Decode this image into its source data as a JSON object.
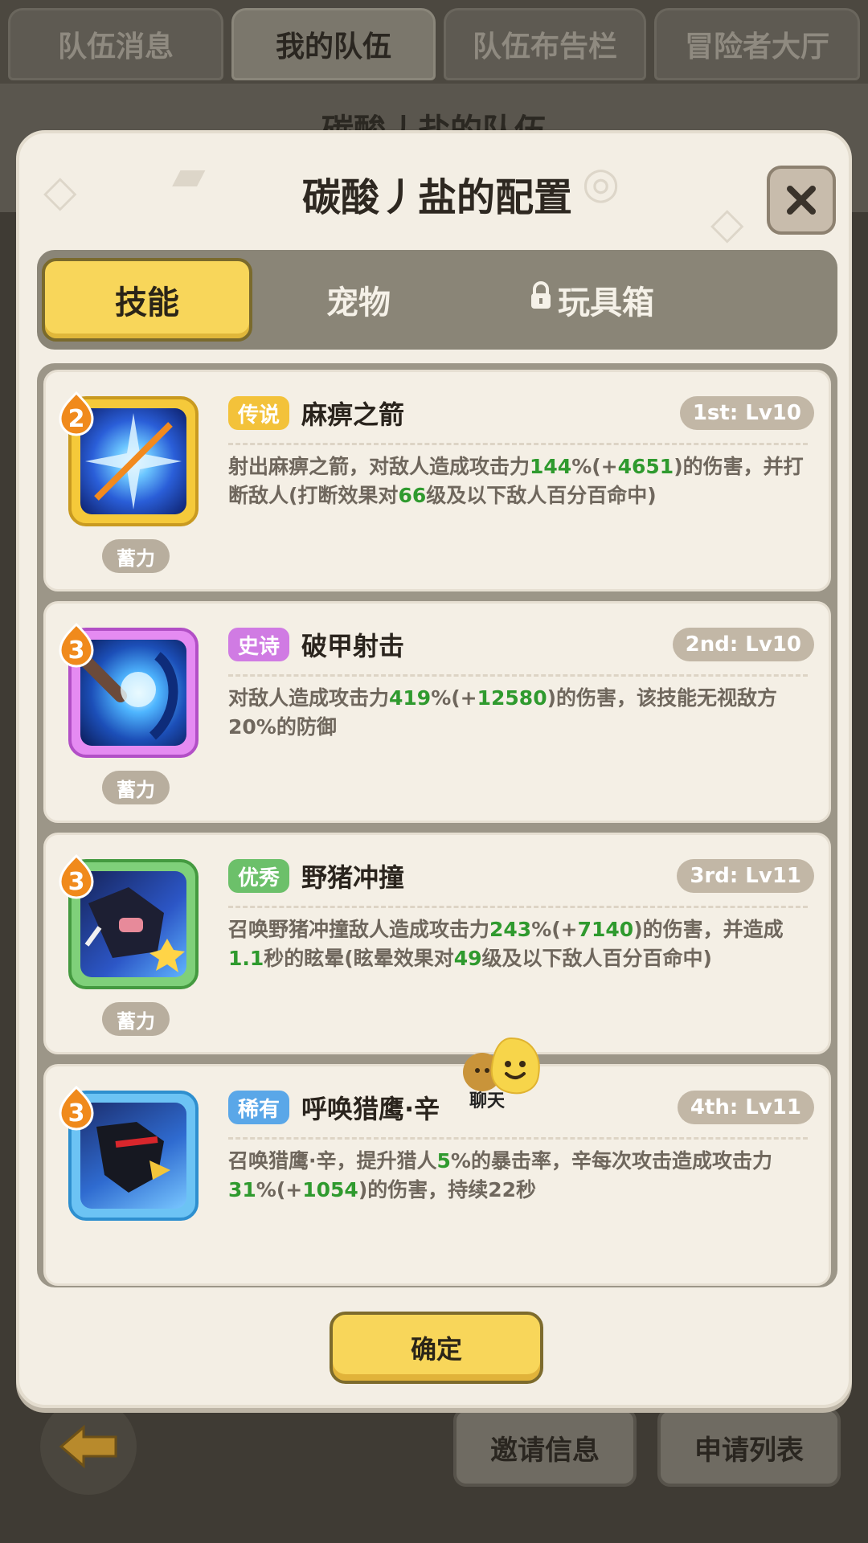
{
  "top_tabs": [
    "队伍消息",
    "我的队伍",
    "队伍布告栏",
    "冒险者大厅"
  ],
  "background_title": "碳酸丿盐的队伍",
  "modal": {
    "title": "碳酸丿盐的配置",
    "tabs": [
      "技能",
      "宠物",
      "玩具箱"
    ],
    "active_tab": "技能",
    "confirm_label": "确定"
  },
  "skills": [
    {
      "rank": "2",
      "rarity": "传说",
      "rarity_color": "#f3c23a",
      "name": "麻痹之箭",
      "level": "1st: Lv10",
      "tag": "蓄力",
      "desc": [
        {
          "t": "射出麻痹之箭，对敌人造成攻击力"
        },
        {
          "t": "144",
          "hl": true
        },
        {
          "t": "%(+"
        },
        {
          "t": "4651",
          "hl": true
        },
        {
          "t": ")的伤害，并打断敌人(打断效果对"
        },
        {
          "t": "66",
          "hl": true
        },
        {
          "t": "级及以下敌人百分百命中)"
        }
      ]
    },
    {
      "rank": "3",
      "rarity": "史诗",
      "rarity_color": "#d07be3",
      "name": "破甲射击",
      "level": "2nd: Lv10",
      "tag": "蓄力",
      "desc": [
        {
          "t": "对敌人造成攻击力"
        },
        {
          "t": "419",
          "hl": true
        },
        {
          "t": "%(+"
        },
        {
          "t": "12580",
          "hl": true
        },
        {
          "t": ")的伤害，该技能无视敌方20%的防御"
        }
      ]
    },
    {
      "rank": "3",
      "rarity": "优秀",
      "rarity_color": "#6cc06a",
      "name": "野猪冲撞",
      "level": "3rd: Lv11",
      "tag": "蓄力",
      "desc": [
        {
          "t": "召唤野猪冲撞敌人造成攻击力"
        },
        {
          "t": "243",
          "hl": true
        },
        {
          "t": "%(+"
        },
        {
          "t": "7140",
          "hl": true
        },
        {
          "t": ")的伤害，并造成"
        },
        {
          "t": "1.1",
          "hl": true
        },
        {
          "t": "秒的眩晕(眩晕效果对"
        },
        {
          "t": "49",
          "hl": true
        },
        {
          "t": "级及以下敌人百分百命中)"
        }
      ]
    },
    {
      "rank": "3",
      "rarity": "稀有",
      "rarity_color": "#5aa7e8",
      "name": "呼唤猎鹰·辛",
      "level": "4th: Lv11",
      "tag": "",
      "desc": [
        {
          "t": "召唤猎鹰·辛，提升猎人"
        },
        {
          "t": "5",
          "hl": true
        },
        {
          "t": "%的暴击率，辛每次攻击造成攻击力"
        },
        {
          "t": "31",
          "hl": true
        },
        {
          "t": "%(+"
        },
        {
          "t": "1054",
          "hl": true
        },
        {
          "t": ")的伤害，持续22秒"
        }
      ]
    }
  ],
  "chat_label": "聊天",
  "bottom_buttons": [
    "邀请信息",
    "申请列表"
  ],
  "colors": {
    "accent_yellow": "#f8d65a",
    "highlight_green": "#2f9a2e",
    "panel_bg": "#f3eee4"
  }
}
